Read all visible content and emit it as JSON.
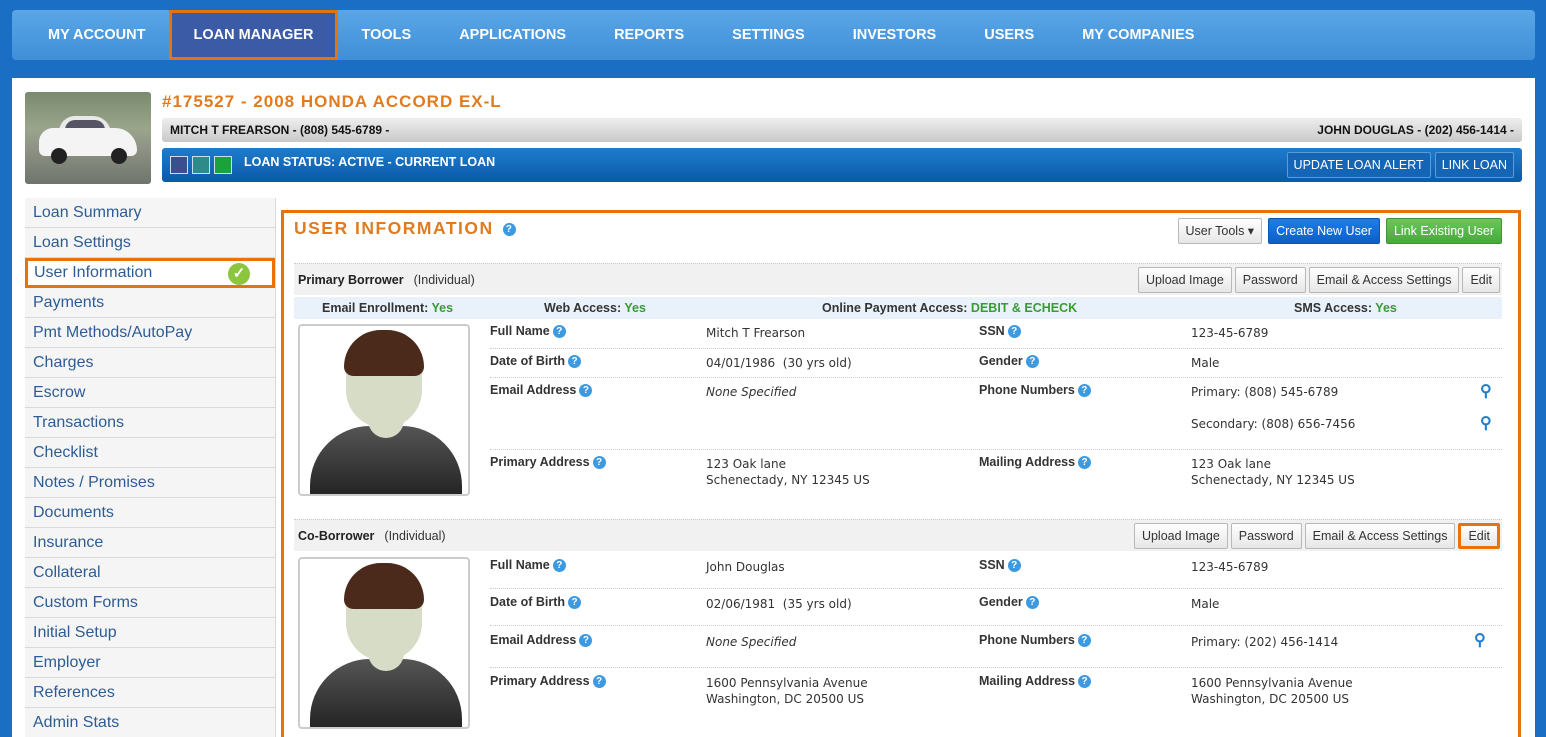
{
  "nav": [
    {
      "label": "MY ACCOUNT"
    },
    {
      "label": "LOAN MANAGER"
    },
    {
      "label": "TOOLS"
    },
    {
      "label": "APPLICATIONS"
    },
    {
      "label": "REPORTS"
    },
    {
      "label": "SETTINGS"
    },
    {
      "label": "INVESTORS"
    },
    {
      "label": "USERS"
    },
    {
      "label": "MY COMPANIES"
    }
  ],
  "loan": {
    "title": "#175527 - 2008 HONDA ACCORD EX-L",
    "borrower_line": "MITCH T FREARSON - (808) 545-6789 -",
    "coborrower_line": "JOHN DOUGLAS - (202) 456-1414 -",
    "status": "LOAN STATUS: ACTIVE - CURRENT LOAN",
    "update_alert": "UPDATE LOAN ALERT",
    "link_loan": "LINK LOAN",
    "status_colors": [
      "#3b4f8f",
      "#2f8a8a",
      "#1aa33a"
    ]
  },
  "sidebar": [
    {
      "label": "Loan Summary"
    },
    {
      "label": "Loan Settings"
    },
    {
      "label": "User Information"
    },
    {
      "label": "Payments"
    },
    {
      "label": "Pmt Methods/AutoPay"
    },
    {
      "label": "Charges"
    },
    {
      "label": "Escrow"
    },
    {
      "label": "Transactions"
    },
    {
      "label": "Checklist"
    },
    {
      "label": "Notes / Promises"
    },
    {
      "label": "Documents"
    },
    {
      "label": "Insurance"
    },
    {
      "label": "Collateral"
    },
    {
      "label": "Custom Forms"
    },
    {
      "label": "Initial Setup"
    },
    {
      "label": "Employer"
    },
    {
      "label": "References"
    },
    {
      "label": "Admin Stats"
    }
  ],
  "main": {
    "title": "USER INFORMATION",
    "user_tools": "User Tools",
    "create_user": "Create New User",
    "link_user": "Link Existing User",
    "buttons": {
      "upload": "Upload Image",
      "password": "Password",
      "email_access": "Email & Access Settings",
      "edit": "Edit"
    },
    "access": {
      "email_label": "Email Enrollment:",
      "email_value": "Yes",
      "web_label": "Web Access:",
      "web_value": "Yes",
      "online_label": "Online Payment Access:",
      "online_value": "DEBIT & ECHECK",
      "sms_label": "SMS Access:",
      "sms_value": "Yes"
    },
    "labels": {
      "full_name": "Full Name",
      "ssn": "SSN",
      "dob": "Date of Birth",
      "gender": "Gender",
      "email": "Email Address",
      "phones": "Phone Numbers",
      "primary_address": "Primary Address",
      "mailing_address": "Mailing Address"
    },
    "primary": {
      "role": "Primary Borrower",
      "type": "(Individual)",
      "full_name": "Mitch T Frearson",
      "ssn": "123-45-6789",
      "dob": "04/01/1986  (30 yrs old)",
      "gender": "Male",
      "email": "None Specified",
      "phone_primary": "Primary: (808) 545-6789",
      "phone_secondary": "Secondary: (808) 656-7456",
      "addr_line1": "123 Oak lane",
      "addr_line2": "Schenectady, NY 12345 US",
      "mail_line1": "123 Oak lane",
      "mail_line2": "Schenectady, NY 12345 US"
    },
    "co": {
      "role": "Co-Borrower",
      "type": "(Individual)",
      "full_name": "John Douglas",
      "ssn": "123-45-6789",
      "dob": "02/06/1981  (35 yrs old)",
      "gender": "Male",
      "email": "None Specified",
      "phone_primary": "Primary: (202) 456-1414",
      "addr_line1": "1600 Pennsylvania Avenue",
      "addr_line2": "Washington, DC 20500 US",
      "mail_line1": "1600 Pennsylvania Avenue",
      "mail_line2": "Washington, DC 20500 US"
    }
  }
}
